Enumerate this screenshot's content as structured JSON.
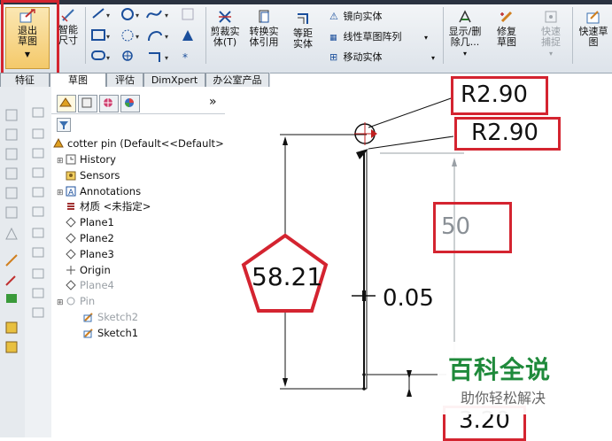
{
  "ribbon": {
    "exit_sketch": "退出草图",
    "smart_dim": "智能尺寸",
    "trim": "剪裁实体(T)",
    "convert": "转换实体引用",
    "offset": "等距实体",
    "mirror": "镜向实体",
    "linear_pattern": "线性草图阵列",
    "move": "移动实体",
    "show_delete": "显示/删除几...",
    "repair": "修复草图",
    "quick_snap": "快速捕捉",
    "quick_sketch": "快速草图"
  },
  "tabs": [
    "特征",
    "草图",
    "评估",
    "DimXpert",
    "办公室产品"
  ],
  "active_tab": 1,
  "panel": {
    "expand_label": "»",
    "root": "cotter pin  (Default<<Default>",
    "items": [
      {
        "label": "History",
        "icon": "history-icon",
        "expander": true,
        "grayed": false
      },
      {
        "label": "Sensors",
        "icon": "sensors-icon",
        "expander": false,
        "grayed": false
      },
      {
        "label": "Annotations",
        "icon": "annotations-icon",
        "expander": true,
        "grayed": false
      },
      {
        "label": "材质 <未指定>",
        "icon": "material-icon",
        "expander": false,
        "grayed": false
      },
      {
        "label": "Plane1",
        "icon": "plane-icon",
        "expander": false,
        "grayed": false
      },
      {
        "label": "Plane2",
        "icon": "plane-icon",
        "expander": false,
        "grayed": false
      },
      {
        "label": "Plane3",
        "icon": "plane-icon",
        "expander": false,
        "grayed": false
      },
      {
        "label": "Origin",
        "icon": "origin-icon",
        "expander": false,
        "grayed": false
      },
      {
        "label": "Plane4",
        "icon": "plane-icon",
        "expander": false,
        "grayed": true
      },
      {
        "label": "Pin",
        "icon": "pin-feature-icon",
        "expander": true,
        "grayed": true
      },
      {
        "label": "Sketch2",
        "icon": "sketch-icon",
        "expander": false,
        "grayed": true
      },
      {
        "label": "Sketch1",
        "icon": "sketch-icon",
        "expander": false,
        "grayed": false
      }
    ]
  },
  "canvas": {
    "dim_radius_top": "R2.90",
    "dim_radius_second": "R2.90",
    "dim_length": "50",
    "dim_height": "58.21",
    "dim_gap": "0.05",
    "dim_width": "3.20"
  },
  "watermark": {
    "title": "百科全说",
    "subtitle": "助你轻松解决"
  },
  "colors": {
    "annotation_red": "#d42430",
    "watermark_green": "#1f8a3b"
  }
}
